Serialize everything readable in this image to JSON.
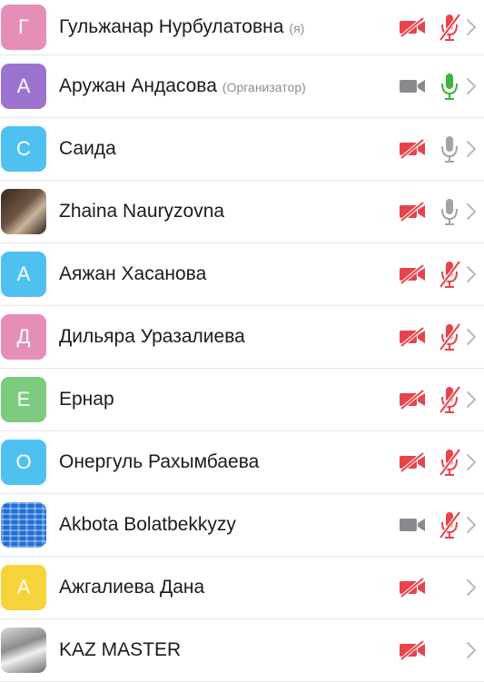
{
  "participants": [
    {
      "initial": "Г",
      "avatar": "initial",
      "color": "#e58fb8",
      "name": "Гульжанар Нурбулатовна",
      "tag": "(я)",
      "camera": "off",
      "mic": "muted"
    },
    {
      "initial": "А",
      "avatar": "initial",
      "color": "#9b73cf",
      "name": "Аружан Андасова",
      "tag": "(Организатор)",
      "camera": "on",
      "mic": "active"
    },
    {
      "initial": "С",
      "avatar": "initial",
      "color": "#4fc1f0",
      "name": "Саида",
      "tag": "",
      "camera": "off",
      "mic": "idle"
    },
    {
      "initial": "",
      "avatar": "photo1",
      "color": "#5a4a3c",
      "name": "Zhaina Nauryzovna",
      "tag": "",
      "camera": "off",
      "mic": "idle"
    },
    {
      "initial": "А",
      "avatar": "initial",
      "color": "#4fc1f0",
      "name": "Аяжан Хасанова",
      "tag": "",
      "camera": "off",
      "mic": "muted"
    },
    {
      "initial": "Д",
      "avatar": "initial",
      "color": "#e58fb8",
      "name": "Дильяра Уразалиева",
      "tag": "",
      "camera": "off",
      "mic": "muted"
    },
    {
      "initial": "Е",
      "avatar": "initial",
      "color": "#7ccb7f",
      "name": "Ернар",
      "tag": "",
      "camera": "off",
      "mic": "muted"
    },
    {
      "initial": "О",
      "avatar": "initial",
      "color": "#4fc1f0",
      "name": "Онергуль Рахымбаева",
      "tag": "",
      "camera": "off",
      "mic": "muted"
    },
    {
      "initial": "",
      "avatar": "photo2",
      "color": "#1f6fd6",
      "name": "Akbota Bolatbekkyzy",
      "tag": "",
      "camera": "on",
      "mic": "muted"
    },
    {
      "initial": "А",
      "avatar": "initial",
      "color": "#f6d33a",
      "name": "Ажгалиева Дана",
      "tag": "",
      "camera": "off",
      "mic": "none"
    },
    {
      "initial": "",
      "avatar": "photo3",
      "color": "#9a9a9a",
      "name": "KAZ MASTER",
      "tag": "",
      "camera": "off",
      "mic": "none"
    }
  ],
  "colors": {
    "muted": "#e8434b",
    "idle": "#a4a4a8",
    "active": "#3ab43a",
    "camera_on": "#8a8a8e",
    "chevron": "#b9b9be"
  },
  "icons": {
    "camera": "video-camera-icon",
    "camera_off": "video-camera-off-icon",
    "mic": "microphone-icon",
    "mic_off": "microphone-off-icon",
    "chevron": "chevron-right-icon"
  }
}
